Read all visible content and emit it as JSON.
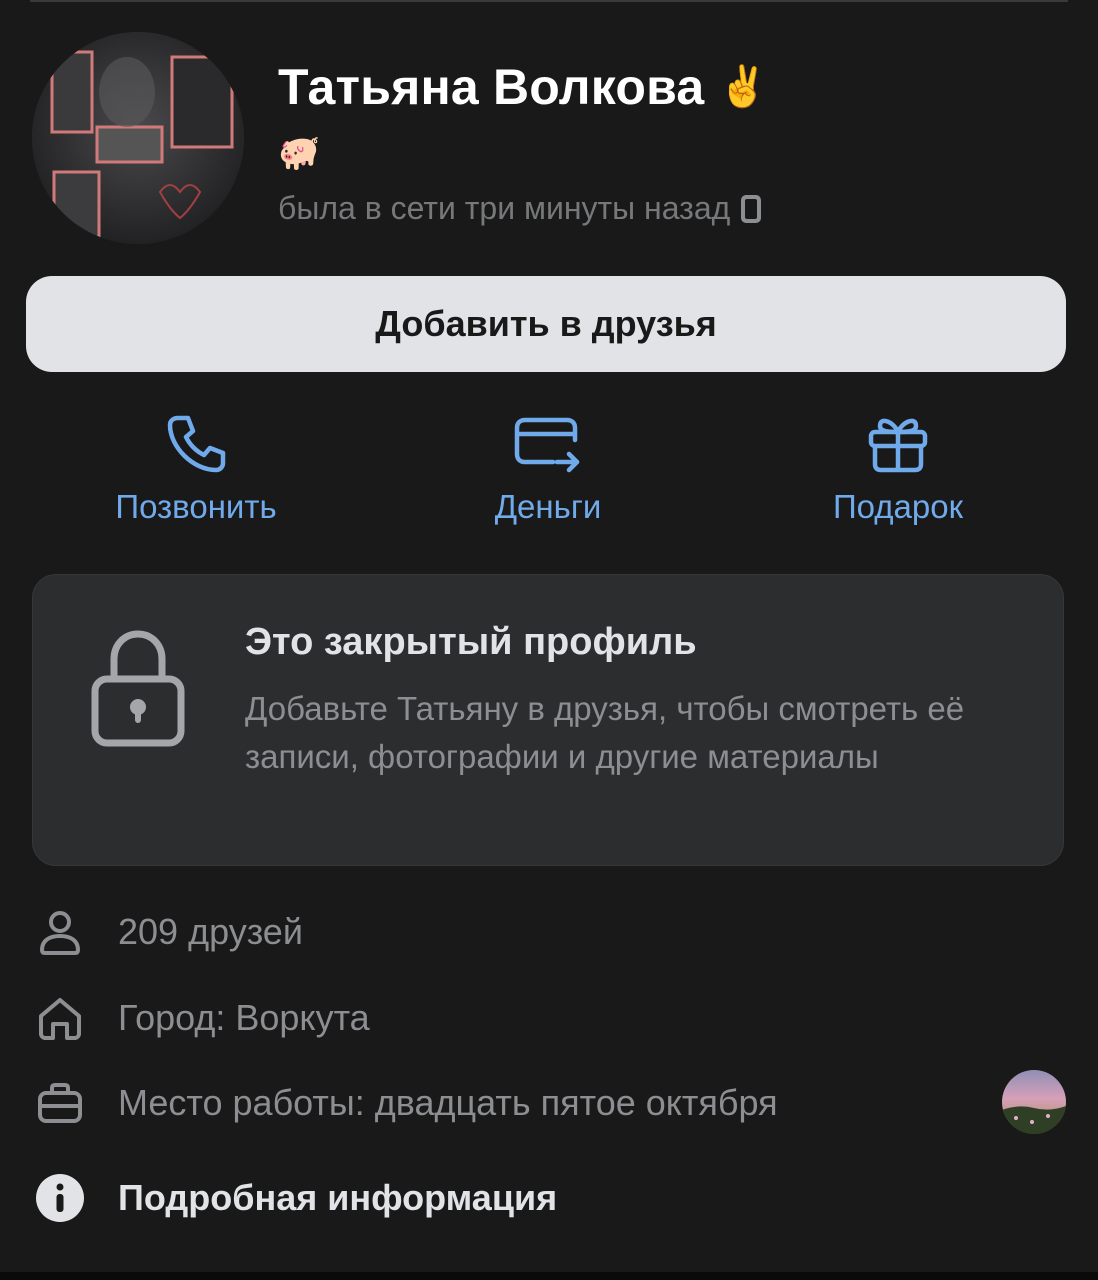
{
  "profile": {
    "name": "Татьяна Волкова",
    "name_emoji": "✌️",
    "status_emoji": "🐖",
    "online_status": "была в сети три минуты назад",
    "device_icon": "phone-icon"
  },
  "add_friend_button": "Добавить в друзья",
  "actions": [
    {
      "label": "Позвонить",
      "icon": "phone-call-icon"
    },
    {
      "label": "Деньги",
      "icon": "card-transfer-icon"
    },
    {
      "label": "Подарок",
      "icon": "gift-icon"
    }
  ],
  "private_card": {
    "title": "Это закрытый профиль",
    "text": "Добавьте Татьяну в друзья, чтобы смотреть её записи, фотографии и другие материалы",
    "icon": "lock-icon"
  },
  "info": {
    "friends": "209 друзей",
    "city": "Город: Воркута",
    "work": "Место работы: двадцать пятое октября",
    "details": "Подробная информация"
  },
  "colors": {
    "background": "#19191a",
    "accent": "#71aaeb",
    "button": "#e1e3e6",
    "card": "#2c2d2e",
    "secondary_text": "#8d8e91"
  }
}
